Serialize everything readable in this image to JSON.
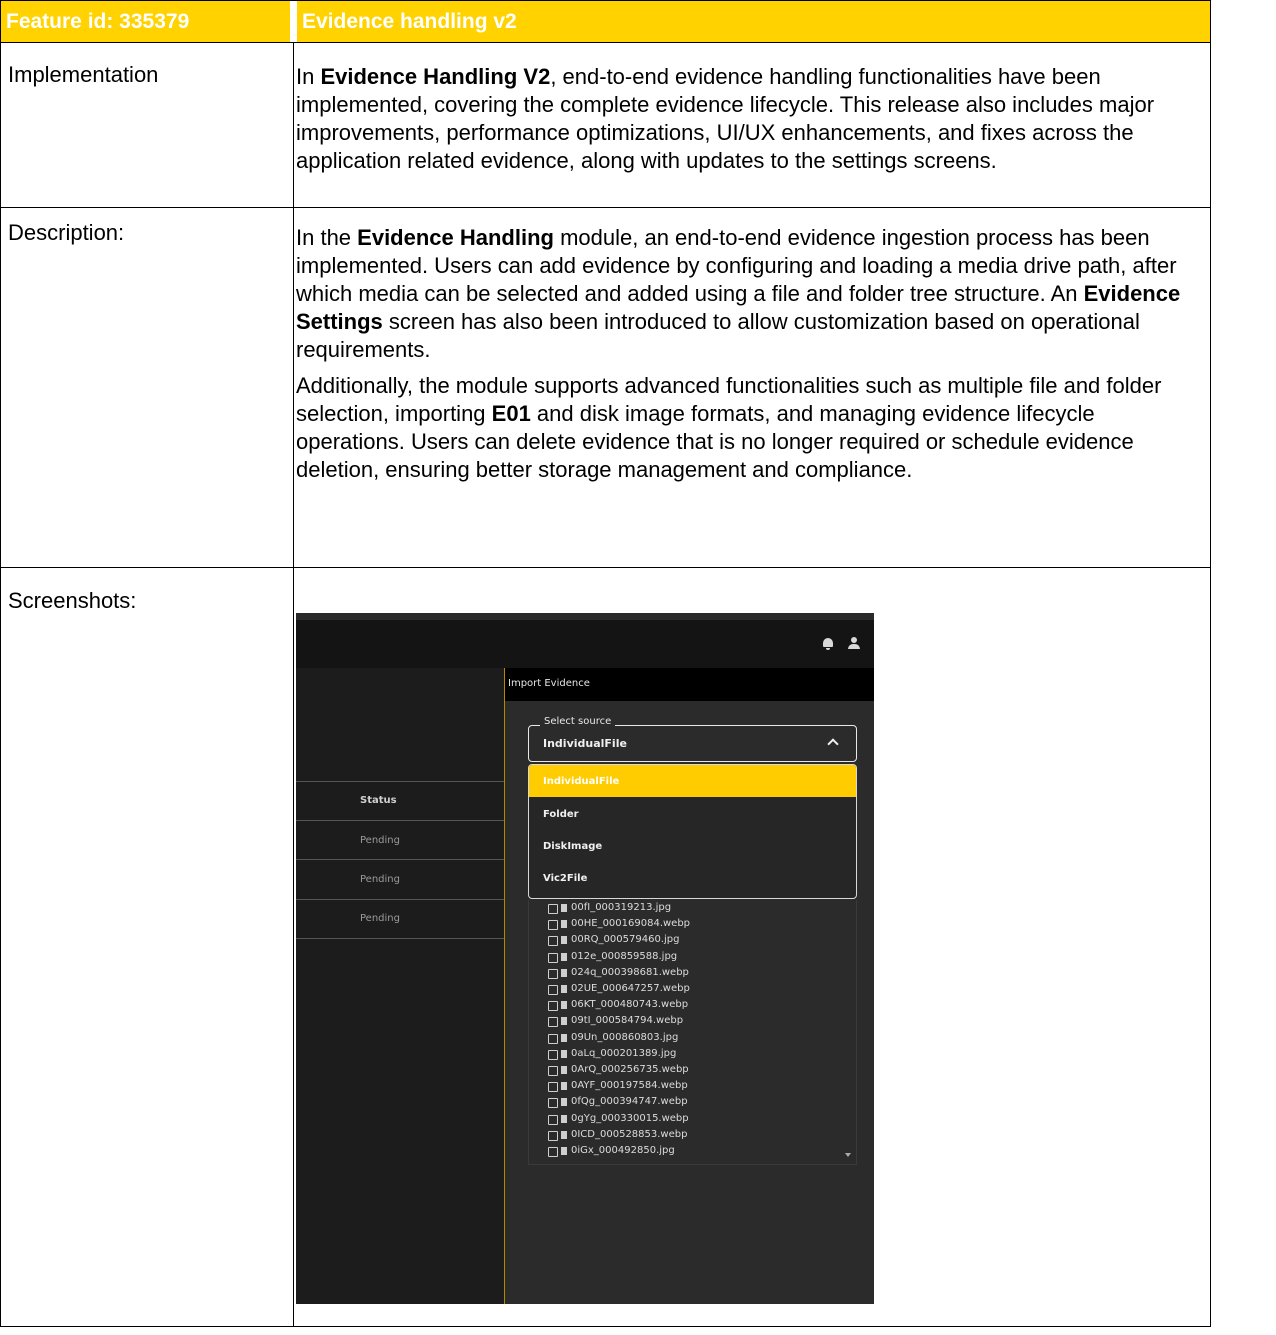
{
  "header": {
    "feature_id": "Feature id: 335379",
    "feature_name": "Evidence handling v2"
  },
  "rows": {
    "implementation_label": "Implementation",
    "implementation_text": [
      {
        "text": "In ",
        "bold": false
      },
      {
        "text": "Evidence Handling V2",
        "bold": true
      },
      {
        "text": ", end-to-end evidence handling functionalities have been implemented, covering the complete evidence lifecycle. This release also includes major improvements, performance optimizations, UI/UX enhancements, and fixes across the application related evidence, along with updates to the settings screens.",
        "bold": false
      }
    ],
    "description_label": "Description:",
    "description_p1": [
      {
        "text": "In the ",
        "bold": false
      },
      {
        "text": "Evidence Handling",
        "bold": true
      },
      {
        "text": " module, an end-to-end evidence ingestion process has been implemented. Users can add evidence by configuring and loading a media drive path, after which media can be selected and added using a file and folder tree structure. An ",
        "bold": false
      },
      {
        "text": "Evidence Settings",
        "bold": true
      },
      {
        "text": " screen has also been introduced to allow customization based on operational requirements.",
        "bold": false
      }
    ],
    "description_p2": [
      {
        "text": "Additionally, the module supports advanced functionalities such as multiple file and folder selection, importing ",
        "bold": false
      },
      {
        "text": "E01",
        "bold": true
      },
      {
        "text": " and disk image formats, and managing evidence lifecycle operations. Users can delete evidence that is no longer required or schedule evidence deletion, ensuring better storage management and compliance.",
        "bold": false
      }
    ],
    "screenshots_label": "Screenshots:"
  },
  "screenshot": {
    "table_header_status": "Status",
    "status_values": [
      "Pending",
      "Pending",
      "Pending"
    ],
    "panel_title": "Import Evidence",
    "select_legend": "Select source",
    "select_value": "IndividualFile",
    "options": [
      "IndividualFile",
      "Folder",
      "DiskImage",
      "Vic2File"
    ],
    "files": [
      "00fI_000319213.jpg",
      "00HE_000169084.webp",
      "00RQ_000579460.jpg",
      "012e_000859588.jpg",
      "024q_000398681.webp",
      "02UE_000647257.webp",
      "06KT_000480743.webp",
      "09tI_000584794.webp",
      "09Un_000860803.jpg",
      "0aLq_000201389.jpg",
      "0ArQ_000256735.webp",
      "0AYF_000197584.webp",
      "0fQg_000394747.webp",
      "0gYg_000330015.webp",
      "0ICD_000528853.webp",
      "0iGx_000492850.jpg"
    ],
    "icons": [
      "bell-icon",
      "user-icon",
      "chevron-up-icon",
      "checkbox-icon",
      "file-icon",
      "scroll-down-icon"
    ]
  }
}
